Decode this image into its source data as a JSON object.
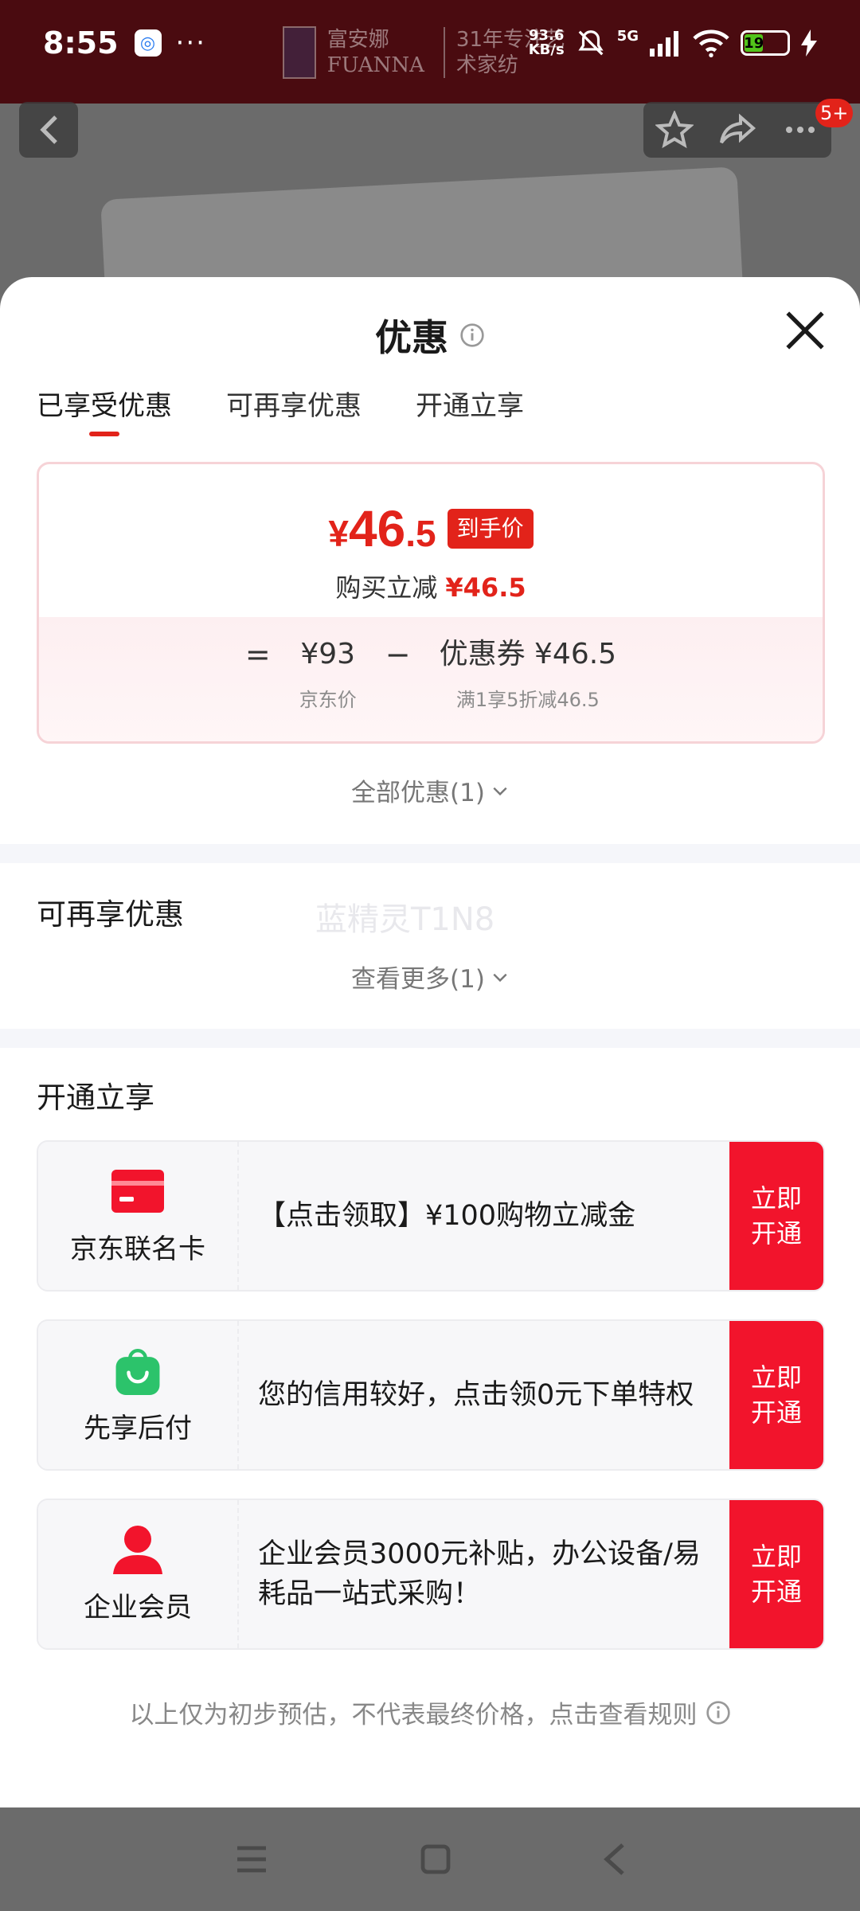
{
  "status_bar": {
    "time": "8:55",
    "more": "···",
    "net_speed_value": "93.6",
    "net_speed_unit": "KB/s",
    "signal_label": "5G",
    "battery": "19"
  },
  "background": {
    "brand_name_cn": "富安娜",
    "brand_name_en": "FUANNA",
    "brand_slogan": "31年专注艺术家纺",
    "notification_badge": "5+"
  },
  "sheet": {
    "title": "优惠",
    "tabs": [
      {
        "label": "已享受优惠",
        "active": true
      },
      {
        "label": "可再享优惠",
        "active": false
      },
      {
        "label": "开通立享",
        "active": false
      }
    ],
    "price_card": {
      "currency": "¥",
      "price_int": "46",
      "price_dec": ".5",
      "price_tag": "到手价",
      "reduction_label": "购买立减",
      "reduction_value": "¥46.5",
      "formula_eq": "=",
      "jd_price": "¥93",
      "jd_price_label": "京东价",
      "formula_minus": "−",
      "coupon_value": "优惠券 ¥46.5",
      "coupon_label": "满1享5折减46.5"
    },
    "all_offers_link": "全部优惠(1)",
    "more_offers_section": {
      "title": "可再享优惠",
      "watermark": "蓝精灵T1N8",
      "see_more_link": "查看更多(1)"
    },
    "open_section": {
      "title": "开通立享",
      "items": [
        {
          "label": "京东联名卡",
          "icon": "card-icon",
          "desc": "【点击领取】¥100购物立减金",
          "button": "立即开通"
        },
        {
          "label": "先享后付",
          "icon": "shopping-bag-icon",
          "desc": "您的信用较好，点击领0元下单特权",
          "button": "立即开通"
        },
        {
          "label": "企业会员",
          "icon": "person-icon",
          "desc": "企业会员3000元补贴，办公设备/易耗品一站式采购！",
          "button": "立即开通"
        }
      ]
    },
    "disclaimer": "以上仅为初步预估，不代表最终价格，点击查看规则"
  },
  "colors": {
    "accent_red": "#e2231a",
    "button_red": "#f2142c",
    "green": "#2cc36b"
  }
}
